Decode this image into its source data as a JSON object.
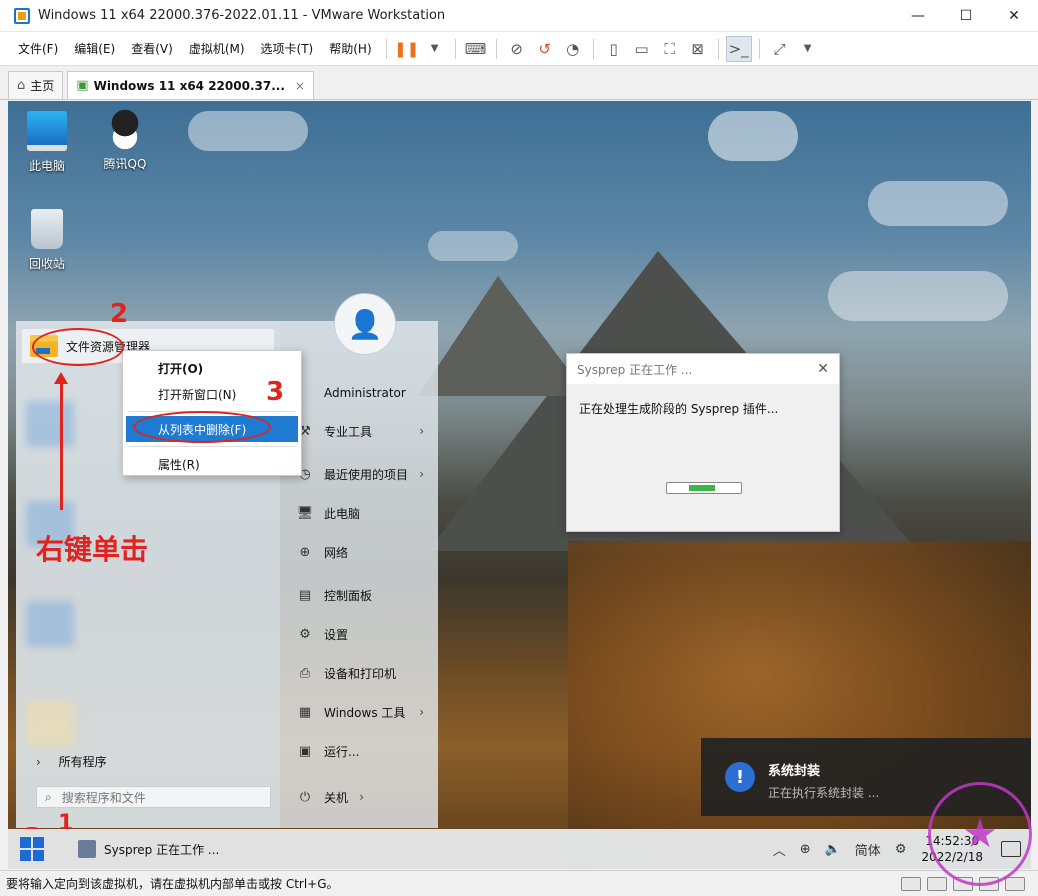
{
  "window": {
    "title": "Windows 11 x64 22000.376-2022.01.11 - VMware Workstation",
    "minimize": "—",
    "maximize": "☐",
    "close": "✕"
  },
  "menubar": {
    "items": [
      "文件(F)",
      "编辑(E)",
      "查看(V)",
      "虚拟机(M)",
      "选项卡(T)",
      "帮助(H)"
    ]
  },
  "tabs": [
    {
      "label": "主页",
      "icon": "home-icon"
    },
    {
      "label": "Windows 11 x64 22000.37...",
      "icon": "vm-icon",
      "close": "×"
    }
  ],
  "desktop": {
    "icons": [
      {
        "label": "此电脑",
        "icon": "computer-icon"
      },
      {
        "label": "腾讯QQ",
        "icon": "qq-penguin-icon"
      },
      {
        "label": "回收站",
        "icon": "recycle-bin-icon"
      }
    ]
  },
  "start_menu": {
    "pinned_item": "文件资源管理器",
    "all_programs": "所有程序",
    "search_placeholder": "搜索程序和文件",
    "user": "Administrator",
    "right_items": [
      {
        "label": "专业工具",
        "icon": "tools-icon",
        "chevron": true
      },
      {
        "label": "最近使用的项目",
        "icon": "recent-icon",
        "chevron": true
      },
      {
        "label": "此电脑",
        "icon": "computer-icon",
        "chevron": false
      },
      {
        "label": "网络",
        "icon": "network-icon",
        "chevron": false
      },
      {
        "label": "控制面板",
        "icon": "control-panel-icon",
        "chevron": false
      },
      {
        "label": "设置",
        "icon": "gear-icon",
        "chevron": false
      },
      {
        "label": "设备和打印机",
        "icon": "printer-icon",
        "chevron": false
      },
      {
        "label": "Windows 工具",
        "icon": "windows-tools-icon",
        "chevron": true
      },
      {
        "label": "运行...",
        "icon": "run-icon",
        "chevron": false
      },
      {
        "label": "关机",
        "icon": "power-icon",
        "chevron": true
      }
    ]
  },
  "context_menu": {
    "items": [
      "打开(O)",
      "打开新窗口(N)",
      "从列表中删除(F)",
      "属性(R)"
    ]
  },
  "annotations": {
    "step1": "1",
    "step2": "2",
    "step3": "3",
    "note": "右键单击"
  },
  "sysprep_dialog": {
    "title": "Sysprep 正在工作 ...",
    "message": "正在处理生成阶段的 Sysprep 插件...",
    "close": "✕"
  },
  "toast": {
    "icon": "!",
    "title": "系统封装",
    "body": "正在执行系统封装 ..."
  },
  "taskbar": {
    "app_label": "Sysprep 正在工作 ...",
    "ime": "简体",
    "time": "14:52:30",
    "date": "2022/2/18"
  },
  "statusbar": {
    "text": "要将输入定向到该虚拟机，请在虚拟机内部单击或按 Ctrl+G。"
  },
  "colors": {
    "accent": "#1f7ad1",
    "annotation": "#e0231f",
    "progress": "#39b54a",
    "watermark": "#c038c8"
  }
}
